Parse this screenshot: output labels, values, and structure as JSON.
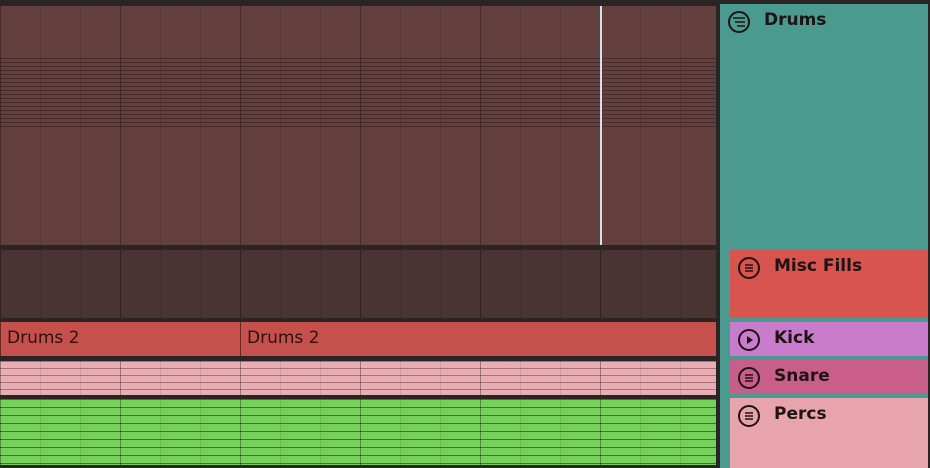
{
  "tracks": {
    "drums": {
      "name": "Drums",
      "color": "#4a9a8f"
    },
    "misc_fills": {
      "name": "Misc Fills",
      "color": "#d8544f"
    },
    "kick": {
      "name": "Kick",
      "color": "#c97ccc"
    },
    "snare": {
      "name": "Snare",
      "color": "#c95e8a"
    },
    "percs": {
      "name": "Percs",
      "color": "#e8a4ad"
    }
  },
  "clips": {
    "kick_clip_1": {
      "label": "Drums 2"
    },
    "kick_clip_2": {
      "label": "Drums 2"
    }
  },
  "icons": {
    "group": "group-fold-icon",
    "menu": "list-icon",
    "play": "play-icon"
  }
}
